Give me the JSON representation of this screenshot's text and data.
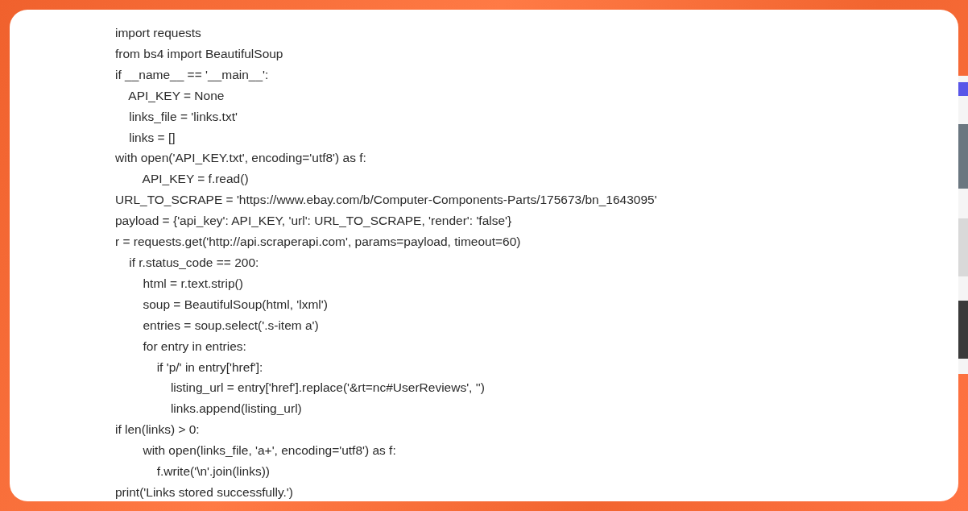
{
  "code_lines": [
    "import requests",
    "from bs4 import BeautifulSoup",
    "if __name__ == '__main__':",
    "    API_KEY = None",
    "    links_file = 'links.txt'",
    "    links = []",
    "with open('API_KEY.txt', encoding='utf8') as f:",
    "        API_KEY = f.read()",
    "URL_TO_SCRAPE = 'https://www.ebay.com/b/Computer-Components-Parts/175673/bn_1643095'",
    "payload = {'api_key': API_KEY, 'url': URL_TO_SCRAPE, 'render': 'false'}",
    "r = requests.get('http://api.scraperapi.com', params=payload, timeout=60)",
    "    if r.status_code == 200:",
    "        html = r.text.strip()",
    "        soup = BeautifulSoup(html, 'lxml')",
    "        entries = soup.select('.s-item a')",
    "        for entry in entries:",
    "            if 'p/' in entry['href']:",
    "                listing_url = entry['href'].replace('&rt=nc#UserReviews', '')",
    "                links.append(listing_url)",
    "if len(links) > 0:",
    "        with open(links_file, 'a+', encoding='utf8') as f:",
    "            f.write('\\n'.join(links))",
    "print('Links stored successfully.')"
  ]
}
